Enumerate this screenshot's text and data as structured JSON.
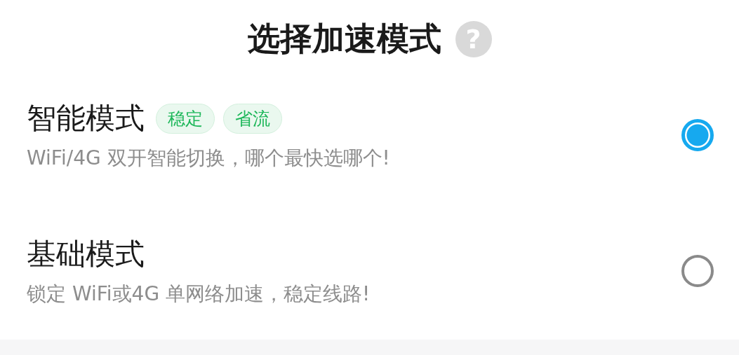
{
  "title": "选择加速模式",
  "help": {
    "label": "?"
  },
  "modes": [
    {
      "name": "智能模式",
      "tags": [
        "稳定",
        "省流"
      ],
      "description": "WiFi/4G 双开智能切换，哪个最快选哪个!",
      "selected": true
    },
    {
      "name": "基础模式",
      "description": "锁定 WiFi或4G 单网络加速，稳定线路!",
      "selected": false
    }
  ]
}
